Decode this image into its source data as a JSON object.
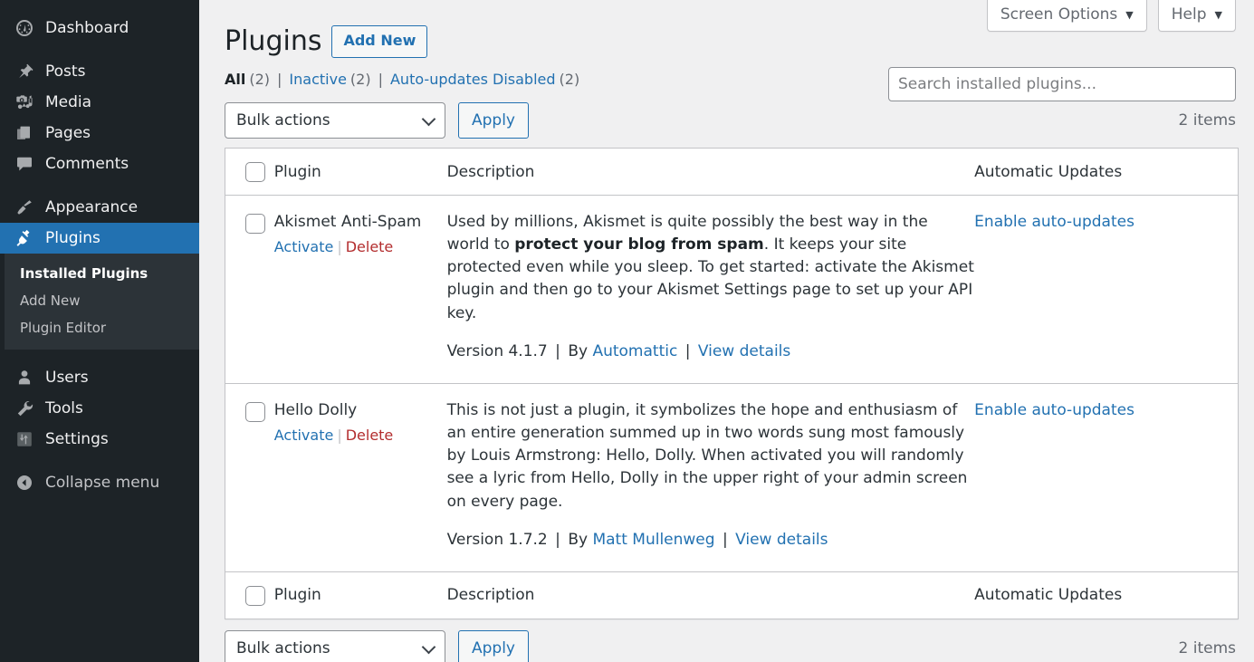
{
  "sidebar": {
    "items": [
      {
        "label": "Dashboard",
        "icon": "dashboard-icon",
        "name": "sidebar-item-dashboard",
        "current": false,
        "gap_after": true
      },
      {
        "label": "Posts",
        "icon": "pin-icon",
        "name": "sidebar-item-posts",
        "current": false,
        "gap_after": false
      },
      {
        "label": "Media",
        "icon": "media-icon",
        "name": "sidebar-item-media",
        "current": false,
        "gap_after": false
      },
      {
        "label": "Pages",
        "icon": "pages-icon",
        "name": "sidebar-item-pages",
        "current": false,
        "gap_after": false
      },
      {
        "label": "Comments",
        "icon": "comments-icon",
        "name": "sidebar-item-comments",
        "current": false,
        "gap_after": true
      },
      {
        "label": "Appearance",
        "icon": "brush-icon",
        "name": "sidebar-item-appearance",
        "current": false,
        "gap_after": false
      },
      {
        "label": "Plugins",
        "icon": "plugin-icon",
        "name": "sidebar-item-plugins",
        "current": true,
        "gap_after": false
      }
    ],
    "submenu": [
      {
        "label": "Installed Plugins",
        "name": "submenu-item-installed-plugins",
        "current": true
      },
      {
        "label": "Add New",
        "name": "submenu-item-add-new",
        "current": false
      },
      {
        "label": "Plugin Editor",
        "name": "submenu-item-plugin-editor",
        "current": false
      }
    ],
    "items_after": [
      {
        "label": "Users",
        "icon": "user-icon",
        "name": "sidebar-item-users",
        "current": false
      },
      {
        "label": "Tools",
        "icon": "wrench-icon",
        "name": "sidebar-item-tools",
        "current": false
      },
      {
        "label": "Settings",
        "icon": "settings-sliders-icon",
        "name": "sidebar-item-settings",
        "current": false
      }
    ],
    "collapse": {
      "label": "Collapse menu",
      "icon": "collapse-arrow-icon",
      "name": "sidebar-item-collapse-menu"
    }
  },
  "screen_meta": {
    "screen_options_label": "Screen Options",
    "help_label": "Help",
    "caret": "▼"
  },
  "header": {
    "title": "Plugins",
    "add_new_label": "Add New"
  },
  "filters": {
    "all": {
      "label": "All",
      "count": "(2)"
    },
    "inactive": {
      "label": "Inactive",
      "count": "(2)"
    },
    "auto_updates_disabled": {
      "label": "Auto-updates Disabled",
      "count": "(2)"
    },
    "divider": "|"
  },
  "search": {
    "placeholder": "Search installed plugins...",
    "value": ""
  },
  "tablenav_top": {
    "bulk_actions_label": "Bulk actions",
    "apply_label": "Apply",
    "items_count": "2 items"
  },
  "tablenav_bottom": {
    "bulk_actions_label": "Bulk actions",
    "apply_label": "Apply",
    "items_count": "2 items"
  },
  "table": {
    "columns": {
      "plugin": "Plugin",
      "description": "Description",
      "automatic_updates": "Automatic Updates"
    },
    "rows": [
      {
        "name": "Akismet Anti-Spam",
        "actions": {
          "activate": "Activate",
          "separator": "|",
          "delete": "Delete"
        },
        "description_part1": "Used by millions, Akismet is quite possibly the best way in the world to ",
        "description_bold": "protect your blog from spam",
        "description_part2": ". It keeps your site protected even while you sleep. To get started: activate the Akismet plugin and then go to your Akismet Settings page to set up your API key.",
        "version_text": "Version 4.1.7",
        "by_text": "By",
        "author": "Automattic",
        "view_details": "View details",
        "auto_update_label": "Enable auto-updates"
      },
      {
        "name": "Hello Dolly",
        "actions": {
          "activate": "Activate",
          "separator": "|",
          "delete": "Delete"
        },
        "description_part1": "This is not just a plugin, it symbolizes the hope and enthusiasm of an entire generation summed up in two words sung most famously by Louis Armstrong: Hello, Dolly. When activated you will randomly see a lyric from Hello, Dolly in the upper right of your admin screen on every page.",
        "description_bold": "",
        "description_part2": "",
        "version_text": "Version 1.7.2",
        "by_text": "By",
        "author": "Matt Mullenweg",
        "view_details": "View details",
        "auto_update_label": "Enable auto-updates"
      }
    ]
  },
  "colors": {
    "sidebar_bg": "#1d2327",
    "submenu_bg": "#2c3338",
    "accent": "#2271b1",
    "delete_red": "#b32d2e",
    "page_bg": "#f0f0f1",
    "border": "#c3c4c7"
  }
}
